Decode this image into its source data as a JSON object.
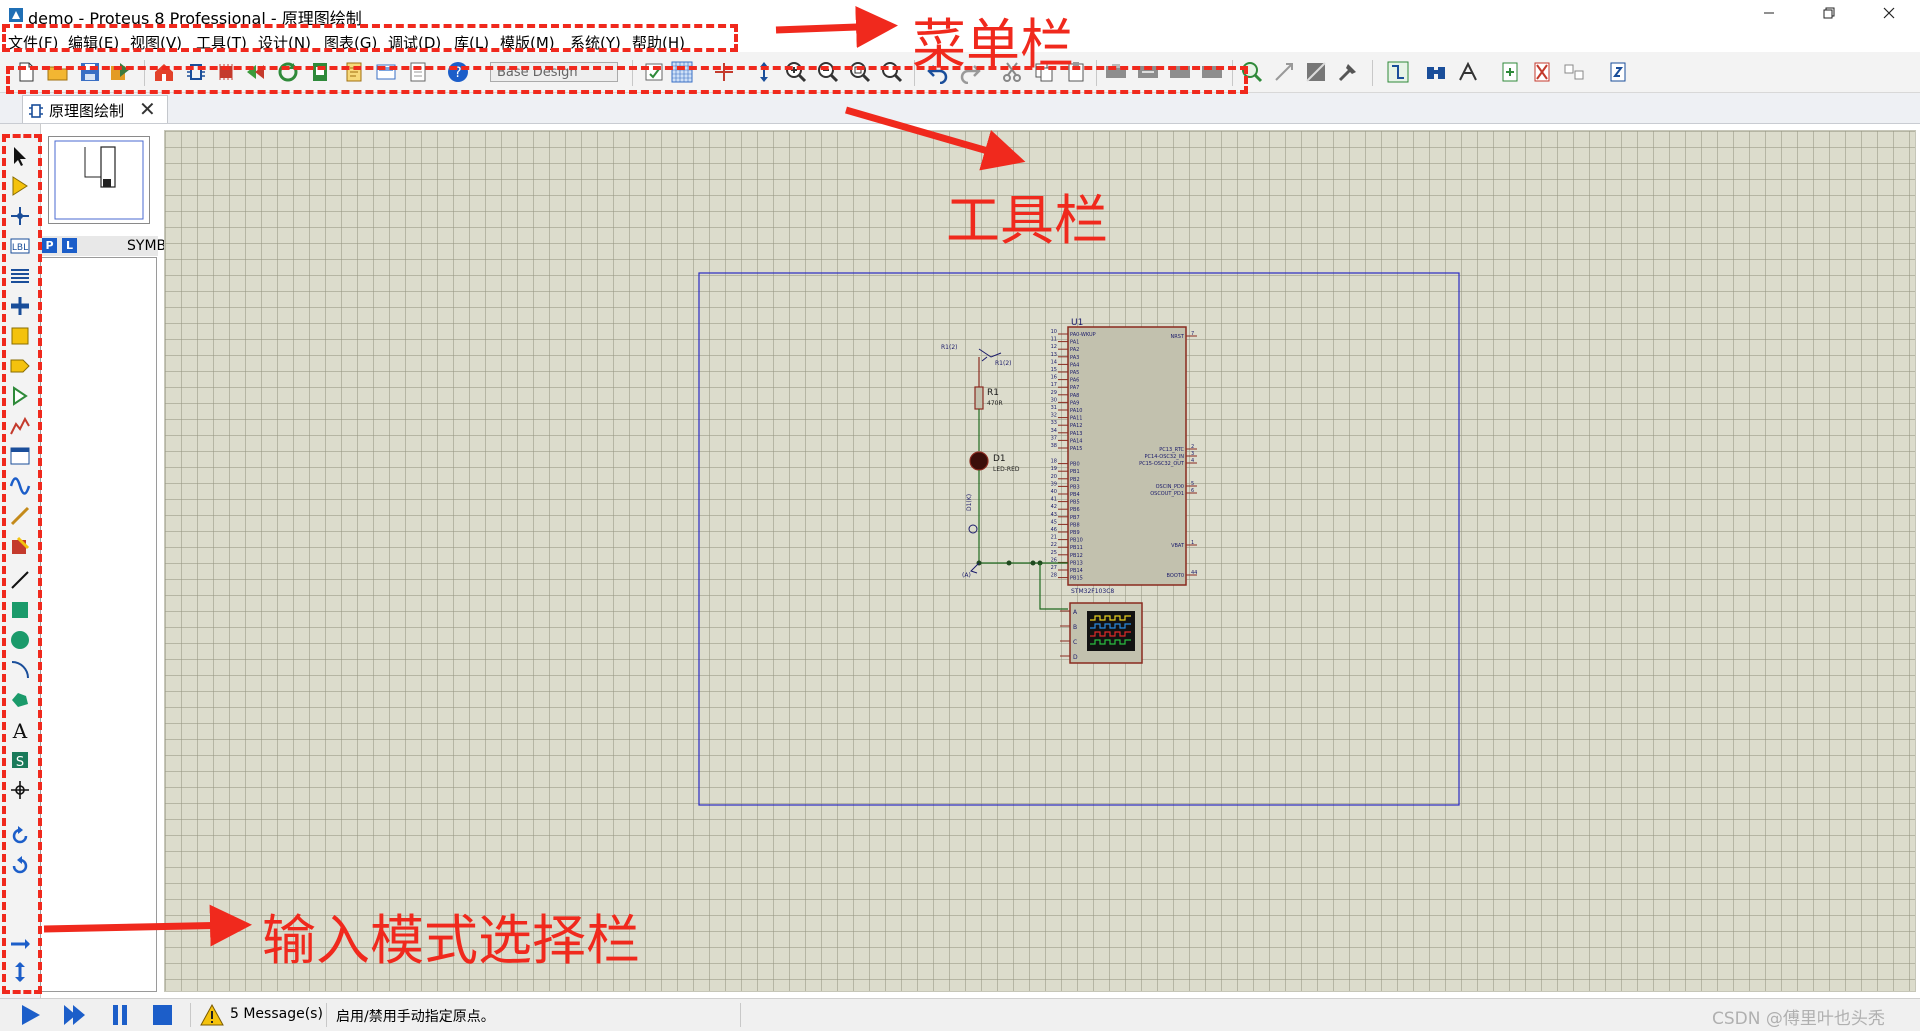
{
  "window": {
    "title": "demo - Proteus 8 Professional - 原理图绘制",
    "controls": [
      "minimize",
      "restore",
      "close"
    ]
  },
  "menu": {
    "items": [
      "文件(F)",
      "编辑(E)",
      "视图(V)",
      "工具(T)",
      "设计(N)",
      "图表(G)",
      "调试(D)",
      "库(L)",
      "模版(M)",
      "系统(Y)",
      "帮助(H)"
    ]
  },
  "toolbar": {
    "variant_combo": "Base Design",
    "icons": [
      "new-file-icon",
      "open-folder-icon",
      "save-icon",
      "import-icon",
      "home-icon",
      "schematic-icon",
      "pcb-icon",
      "back-icon",
      "refresh-icon",
      "export-icon",
      "bom-icon",
      "gallery-icon",
      "report-icon",
      "help-icon",
      "grid-toggle-icon",
      "origin-icon",
      "pan-icon",
      "zoom-in-icon",
      "zoom-out-icon",
      "zoom-all-icon",
      "zoom-area-icon",
      "undo-icon",
      "redo-icon",
      "cut-icon",
      "copy-icon",
      "paste-icon",
      "block-copy-icon",
      "block-move-icon",
      "block-rotate-icon",
      "block-delete-icon",
      "pick-device-icon",
      "make-device-icon",
      "package-tool-icon",
      "decompose-icon",
      "wire-autorouter-icon",
      "search-icon",
      "property-tool-icon",
      "new-sheet-icon",
      "remove-sheet-icon",
      "goto-child-icon",
      "netlist-icon"
    ]
  },
  "tab": {
    "label": "原理图绘制",
    "close_glyph": "✕"
  },
  "mode_buttons": [
    "selection-mode-icon",
    "component-mode-icon",
    "junction-dot-icon",
    "wire-label-icon",
    "text-script-icon",
    "bus-icon",
    "subcircuit-icon",
    "terminal-icon",
    "device-pin-icon",
    "graph-icon",
    "tape-recorder-icon",
    "generator-icon",
    "voltage-probe-icon",
    "current-probe-icon",
    "virtual-instrument-icon",
    "line-icon",
    "box-icon",
    "circle-icon",
    "arc-icon",
    "path-icon",
    "text-icon",
    "symbol-icon",
    "marker-icon",
    "rotate-cw-icon",
    "rotate-ccw-icon",
    "mirror-x-icon",
    "mirror-y-icon"
  ],
  "device_panel": {
    "p_label": "P",
    "l_label": "L",
    "title": "SYMBOLS"
  },
  "schematic": {
    "mcu": {
      "ref": "U1",
      "part": "STM32F103C8",
      "left_pins": [
        {
          "num": "10",
          "name": "PA0-WKUP"
        },
        {
          "num": "11",
          "name": "PA1"
        },
        {
          "num": "12",
          "name": "PA2"
        },
        {
          "num": "13",
          "name": "PA3"
        },
        {
          "num": "14",
          "name": "PA4"
        },
        {
          "num": "15",
          "name": "PA5"
        },
        {
          "num": "16",
          "name": "PA6"
        },
        {
          "num": "17",
          "name": "PA7"
        },
        {
          "num": "29",
          "name": "PA8"
        },
        {
          "num": "30",
          "name": "PA9"
        },
        {
          "num": "31",
          "name": "PA10"
        },
        {
          "num": "32",
          "name": "PA11"
        },
        {
          "num": "33",
          "name": "PA12"
        },
        {
          "num": "34",
          "name": "PA13"
        },
        {
          "num": "37",
          "name": "PA14"
        },
        {
          "num": "38",
          "name": "PA15"
        },
        {
          "num": "18",
          "name": "PB0"
        },
        {
          "num": "19",
          "name": "PB1"
        },
        {
          "num": "20",
          "name": "PB2"
        },
        {
          "num": "39",
          "name": "PB3"
        },
        {
          "num": "40",
          "name": "PB4"
        },
        {
          "num": "41",
          "name": "PB5"
        },
        {
          "num": "42",
          "name": "PB6"
        },
        {
          "num": "43",
          "name": "PB7"
        },
        {
          "num": "45",
          "name": "PB8"
        },
        {
          "num": "46",
          "name": "PB9"
        },
        {
          "num": "21",
          "name": "PB10"
        },
        {
          "num": "22",
          "name": "PB11"
        },
        {
          "num": "25",
          "name": "PB12"
        },
        {
          "num": "26",
          "name": "PB13"
        },
        {
          "num": "27",
          "name": "PB14"
        },
        {
          "num": "28",
          "name": "PB15"
        }
      ],
      "right_pins": [
        {
          "num": "7",
          "name": "NRST"
        },
        {
          "num": "2",
          "name": "PC13_RTC"
        },
        {
          "num": "3",
          "name": "PC14-OSC32_IN"
        },
        {
          "num": "4",
          "name": "PC15-OSC32_OUT"
        },
        {
          "num": "5",
          "name": "OSCIN_PD0"
        },
        {
          "num": "6",
          "name": "OSCOUT_PD1"
        },
        {
          "num": "1",
          "name": "VBAT"
        },
        {
          "num": "44",
          "name": "BOOT0"
        }
      ]
    },
    "resistor": {
      "ref": "R1",
      "value": "470R",
      "probe_a": "R1(2)",
      "probe_b": "R1(2)"
    },
    "led": {
      "ref": "D1",
      "value": "LED-RED",
      "probe": "D1(K)"
    },
    "ground_label": "(A)",
    "scope_channels": [
      "A",
      "B",
      "C",
      "D"
    ]
  },
  "status": {
    "messages": "5 Message(s)",
    "hint": "启用/禁用手动指定原点。",
    "watermark": "CSDN @傅里叶也头秃"
  },
  "annotations": {
    "menubar": "菜单栏",
    "toolbar": "工具栏",
    "modebar": "输入模式选择栏",
    "color": "#f0291d"
  }
}
